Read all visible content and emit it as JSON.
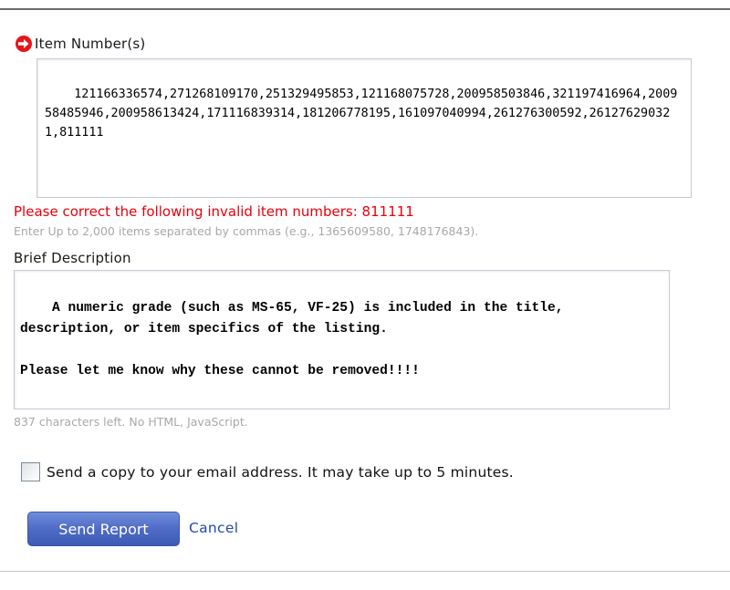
{
  "item_numbers": {
    "label": "Item Number(s)",
    "value": "121166336574,271268109170,251329495853,121168075728,200958503846,321197416964,200958485946,200958613424,171116839314,181206778195,161097040994,261276300592,261276290321,811111",
    "error": "Please correct the following invalid item numbers: 811111",
    "hint": "Enter Up to 2,000 items separated by commas (e.g., 1365609580, 1748176843)."
  },
  "description": {
    "label": "Brief Description",
    "value": "A numeric grade (such as MS-65, VF-25) is included in the title, description, or item specifics of the listing.\n\nPlease let me know why these cannot be removed!!!!",
    "hint": "837 characters left. No HTML, JavaScript."
  },
  "copy_option": {
    "label": "Send a copy to your email address. It may take up to 5 minutes.",
    "checked": false
  },
  "actions": {
    "send_label": "Send Report",
    "cancel_label": "Cancel"
  },
  "colors": {
    "error": "#e8000b",
    "required_icon": "#e8141b",
    "button": "#4e6cc7",
    "link": "#2149b0",
    "hint": "#a8a8a8"
  },
  "icons": {
    "required": "required-arrow-icon",
    "resize": "resize-grip-icon"
  }
}
